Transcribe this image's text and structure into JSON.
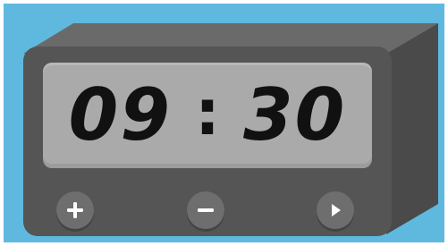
{
  "timer": {
    "minutes": "09",
    "separator": ":",
    "seconds": "30"
  },
  "buttons": {
    "plus_icon": "plus-icon",
    "minus_icon": "minus-icon",
    "play_icon": "play-icon"
  },
  "colors": {
    "background": "#5fb9de",
    "body_front": "#555555",
    "body_top": "#6a6a6a",
    "body_side": "#4a4a4a",
    "display": "#aaaaaa",
    "digits": "#111111",
    "button": "#6e6e6e",
    "button_icon": "#ffffff"
  }
}
